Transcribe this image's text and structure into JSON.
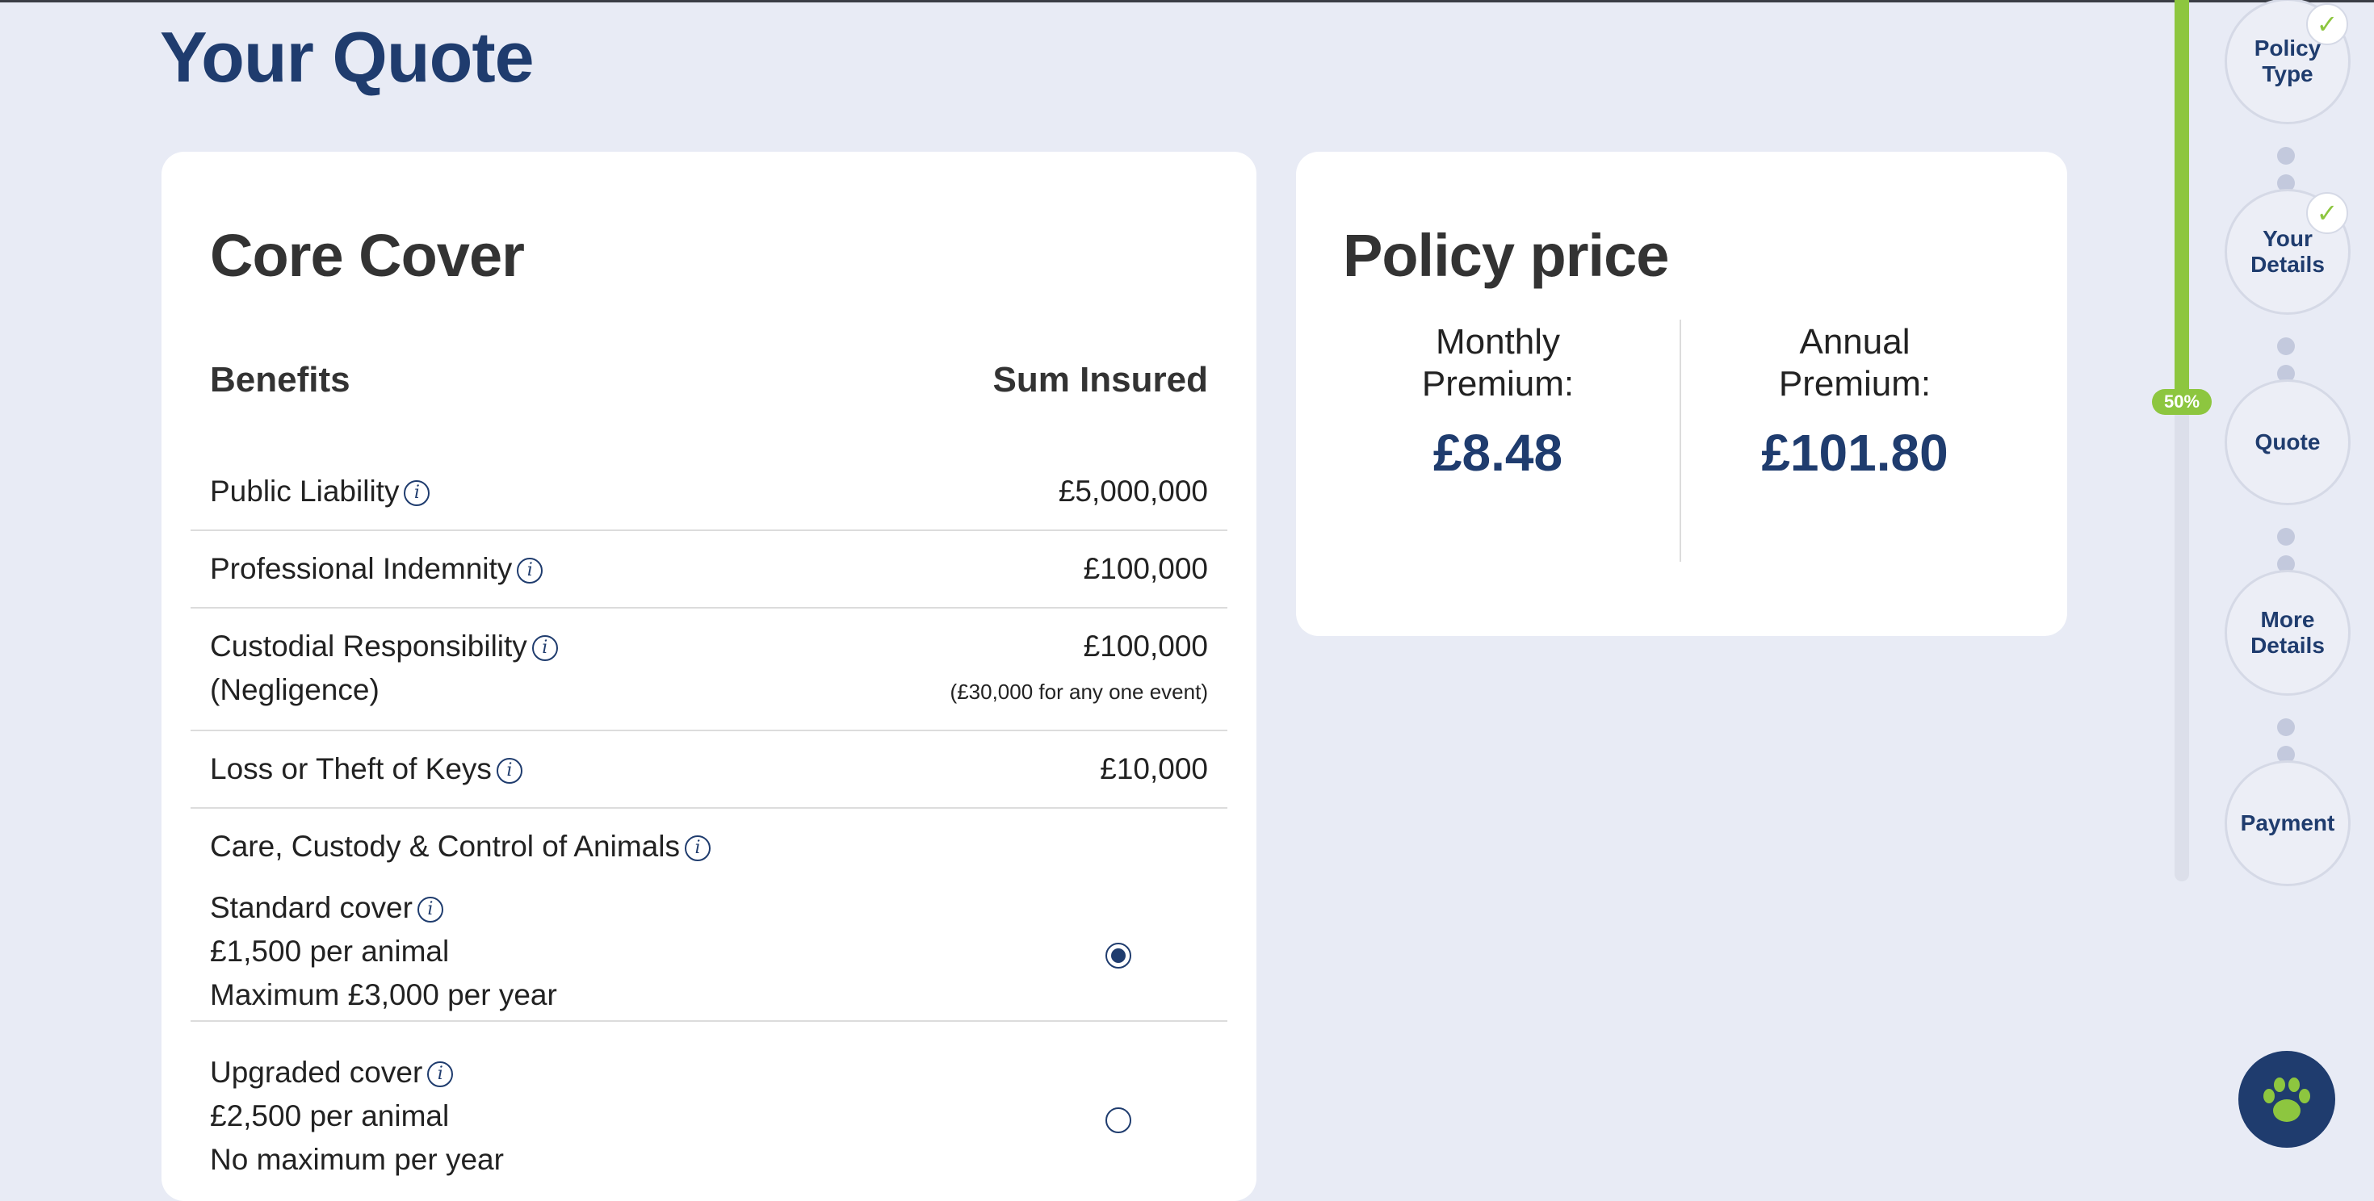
{
  "page": {
    "title": "Your Quote"
  },
  "core_cover": {
    "title": "Core Cover",
    "benefits_header": "Benefits",
    "sum_insured_header": "Sum Insured",
    "rows": [
      {
        "label": "Public Liability",
        "value": "£5,000,000"
      },
      {
        "label": "Professional Indemnity",
        "value": "£100,000"
      },
      {
        "label": "Custodial Responsibility",
        "label_line2": "(Negligence)",
        "value": "£100,000",
        "note": "(£30,000 for any one event)"
      },
      {
        "label": "Loss or Theft of Keys",
        "value": "£10,000"
      }
    ],
    "animals": {
      "label": "Care, Custody & Control of Animals",
      "options": [
        {
          "title": "Standard cover",
          "line2": "£1,500 per animal",
          "line3": "Maximum £3,000 per year",
          "selected": true
        },
        {
          "title": "Upgraded cover",
          "line2": "£2,500 per animal",
          "line3": "No maximum per year",
          "selected": false
        }
      ]
    }
  },
  "policy_price": {
    "title": "Policy price",
    "monthly": {
      "label_line1": "Monthly",
      "label_line2": "Premium:",
      "amount": "£8.48"
    },
    "annual": {
      "label_line1": "Annual",
      "label_line2": "Premium:",
      "amount": "£101.80"
    }
  },
  "progress": {
    "percent_label": "50%",
    "percent": 50,
    "steps": [
      {
        "line1": "Policy",
        "line2": "Type",
        "completed": true
      },
      {
        "line1": "Your",
        "line2": "Details",
        "completed": true
      },
      {
        "line1": "Quote",
        "line2": "",
        "completed": false
      },
      {
        "line1": "More",
        "line2": "Details",
        "completed": false
      },
      {
        "line1": "Payment",
        "line2": "",
        "completed": false
      }
    ],
    "check_glyph": "✓"
  },
  "chat_button": {
    "icon": "paw-icon"
  },
  "colors": {
    "background": "#e8ebf5",
    "brand_navy": "#1f3c6e",
    "accent_green": "#8dc63f"
  }
}
